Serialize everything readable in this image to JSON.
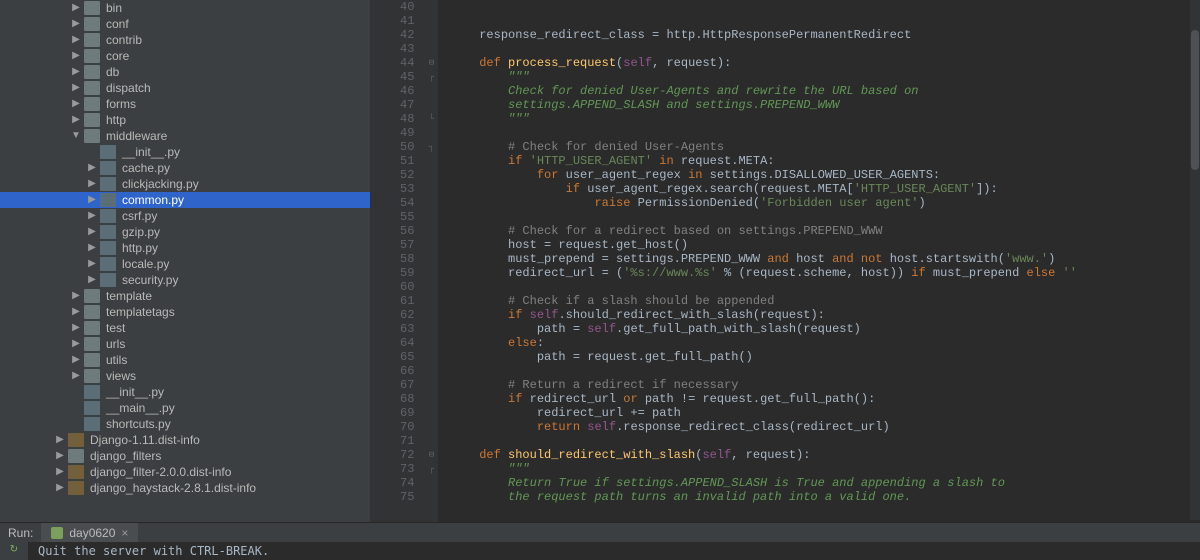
{
  "tree": [
    {
      "depth": 3,
      "arrow": "right",
      "icon": "folder",
      "label": "bin"
    },
    {
      "depth": 3,
      "arrow": "right",
      "icon": "folder",
      "label": "conf"
    },
    {
      "depth": 3,
      "arrow": "right",
      "icon": "folder",
      "label": "contrib"
    },
    {
      "depth": 3,
      "arrow": "right",
      "icon": "folder",
      "label": "core"
    },
    {
      "depth": 3,
      "arrow": "right",
      "icon": "folder",
      "label": "db"
    },
    {
      "depth": 3,
      "arrow": "right",
      "icon": "folder",
      "label": "dispatch"
    },
    {
      "depth": 3,
      "arrow": "right",
      "icon": "folder",
      "label": "forms"
    },
    {
      "depth": 3,
      "arrow": "right",
      "icon": "folder",
      "label": "http"
    },
    {
      "depth": 3,
      "arrow": "down",
      "icon": "folder",
      "label": "middleware"
    },
    {
      "depth": 4,
      "arrow": "none",
      "icon": "file",
      "label": "__init__.py"
    },
    {
      "depth": 4,
      "arrow": "right",
      "icon": "file",
      "label": "cache.py"
    },
    {
      "depth": 4,
      "arrow": "right",
      "icon": "file",
      "label": "clickjacking.py"
    },
    {
      "depth": 4,
      "arrow": "right",
      "icon": "file",
      "label": "common.py",
      "selected": true
    },
    {
      "depth": 4,
      "arrow": "right",
      "icon": "file",
      "label": "csrf.py"
    },
    {
      "depth": 4,
      "arrow": "right",
      "icon": "file",
      "label": "gzip.py"
    },
    {
      "depth": 4,
      "arrow": "right",
      "icon": "file",
      "label": "http.py"
    },
    {
      "depth": 4,
      "arrow": "right",
      "icon": "file",
      "label": "locale.py"
    },
    {
      "depth": 4,
      "arrow": "right",
      "icon": "file",
      "label": "security.py"
    },
    {
      "depth": 3,
      "arrow": "right",
      "icon": "folder",
      "label": "template"
    },
    {
      "depth": 3,
      "arrow": "right",
      "icon": "folder",
      "label": "templatetags"
    },
    {
      "depth": 3,
      "arrow": "right",
      "icon": "folder",
      "label": "test"
    },
    {
      "depth": 3,
      "arrow": "right",
      "icon": "folder",
      "label": "urls"
    },
    {
      "depth": 3,
      "arrow": "right",
      "icon": "folder",
      "label": "utils"
    },
    {
      "depth": 3,
      "arrow": "right",
      "icon": "folder",
      "label": "views"
    },
    {
      "depth": 3,
      "arrow": "none",
      "icon": "file",
      "label": "__init__.py"
    },
    {
      "depth": 3,
      "arrow": "none",
      "icon": "file",
      "label": "__main__.py"
    },
    {
      "depth": 3,
      "arrow": "none",
      "icon": "file",
      "label": "shortcuts.py"
    },
    {
      "depth": 2,
      "arrow": "right",
      "icon": "dist",
      "label": "Django-1.11.dist-info"
    },
    {
      "depth": 2,
      "arrow": "right",
      "icon": "folder",
      "label": "django_filters"
    },
    {
      "depth": 2,
      "arrow": "right",
      "icon": "dist",
      "label": "django_filter-2.0.0.dist-info"
    },
    {
      "depth": 2,
      "arrow": "right",
      "icon": "dist",
      "label": "django_haystack-2.8.1.dist-info"
    }
  ],
  "lineStart": 40,
  "code": [
    {
      "t": ""
    },
    {
      "t": ""
    },
    {
      "t": "    response_redirect_class = http.HttpResponsePermanentRedirect"
    },
    {
      "t": ""
    },
    {
      "seg": [
        [
          "kw",
          "    def "
        ],
        [
          "fn",
          "process_request"
        ],
        [
          "id",
          "("
        ],
        [
          "self",
          "self"
        ],
        [
          "id",
          ", request):"
        ]
      ]
    },
    {
      "t": "        \"\"\"",
      "cls": "doc"
    },
    {
      "t": "        Check for denied User-Agents and rewrite the URL based on",
      "cls": "doc"
    },
    {
      "t": "        settings.APPEND_SLASH and settings.PREPEND_WWW",
      "cls": "doc"
    },
    {
      "t": "        \"\"\"",
      "cls": "doc"
    },
    {
      "t": ""
    },
    {
      "t": "        # Check for denied User-Agents",
      "cls": "cmt"
    },
    {
      "seg": [
        [
          "id",
          "        "
        ],
        [
          "kw",
          "if "
        ],
        [
          "str",
          "'HTTP_USER_AGENT'"
        ],
        [
          "kw",
          " in "
        ],
        [
          "id",
          "request.META:"
        ]
      ]
    },
    {
      "seg": [
        [
          "id",
          "            "
        ],
        [
          "kw",
          "for "
        ],
        [
          "id",
          "user_agent_regex "
        ],
        [
          "kw",
          "in "
        ],
        [
          "id",
          "settings.DISALLOWED_USER_AGENTS:"
        ]
      ]
    },
    {
      "seg": [
        [
          "id",
          "                "
        ],
        [
          "kw",
          "if "
        ],
        [
          "id",
          "user_agent_regex.search(request.META["
        ],
        [
          "str",
          "'HTTP_USER_AGENT'"
        ],
        [
          "id",
          "]):"
        ]
      ]
    },
    {
      "seg": [
        [
          "id",
          "                    "
        ],
        [
          "kw",
          "raise "
        ],
        [
          "id",
          "PermissionDenied("
        ],
        [
          "str",
          "'Forbidden user agent'"
        ],
        [
          "id",
          ")"
        ]
      ]
    },
    {
      "t": ""
    },
    {
      "t": "        # Check for a redirect based on settings.PREPEND_WWW",
      "cls": "cmt"
    },
    {
      "t": "        host = request.get_host()"
    },
    {
      "seg": [
        [
          "id",
          "        must_prepend = settings.PREPEND_WWW "
        ],
        [
          "kw",
          "and "
        ],
        [
          "id",
          "host "
        ],
        [
          "kw",
          "and not "
        ],
        [
          "id",
          "host.startswith("
        ],
        [
          "str",
          "'www.'"
        ],
        [
          "id",
          ")"
        ]
      ]
    },
    {
      "seg": [
        [
          "id",
          "        redirect_url = ("
        ],
        [
          "str",
          "'%s://www.%s'"
        ],
        [
          "id",
          " % (request.scheme, host)) "
        ],
        [
          "kw",
          "if "
        ],
        [
          "id",
          "must_prepend "
        ],
        [
          "kw",
          "else "
        ],
        [
          "str",
          "''"
        ]
      ]
    },
    {
      "t": ""
    },
    {
      "t": "        # Check if a slash should be appended",
      "cls": "cmt"
    },
    {
      "seg": [
        [
          "id",
          "        "
        ],
        [
          "kw",
          "if "
        ],
        [
          "self",
          "self"
        ],
        [
          "id",
          ".should_redirect_with_slash(request):"
        ]
      ]
    },
    {
      "seg": [
        [
          "id",
          "            path = "
        ],
        [
          "self",
          "self"
        ],
        [
          "id",
          ".get_full_path_with_slash(request)"
        ]
      ]
    },
    {
      "seg": [
        [
          "id",
          "        "
        ],
        [
          "kw",
          "else"
        ],
        [
          "id",
          ":"
        ]
      ]
    },
    {
      "t": "            path = request.get_full_path()"
    },
    {
      "t": ""
    },
    {
      "t": "        # Return a redirect if necessary",
      "cls": "cmt"
    },
    {
      "seg": [
        [
          "id",
          "        "
        ],
        [
          "kw",
          "if "
        ],
        [
          "id",
          "redirect_url "
        ],
        [
          "kw",
          "or "
        ],
        [
          "id",
          "path != request.get_full_path():"
        ]
      ]
    },
    {
      "t": "            redirect_url += path"
    },
    {
      "seg": [
        [
          "id",
          "            "
        ],
        [
          "kw",
          "return "
        ],
        [
          "self",
          "self"
        ],
        [
          "id",
          ".response_redirect_class(redirect_url)"
        ]
      ]
    },
    {
      "t": ""
    },
    {
      "seg": [
        [
          "kw",
          "    def "
        ],
        [
          "fn",
          "should_redirect_with_slash"
        ],
        [
          "id",
          "("
        ],
        [
          "self",
          "self"
        ],
        [
          "id",
          ", request):"
        ]
      ]
    },
    {
      "t": "        \"\"\"",
      "cls": "doc"
    },
    {
      "t": "        Return True if settings.APPEND_SLASH is True and appending a slash to",
      "cls": "doc"
    },
    {
      "t": "        the request path turns an invalid path into a valid one.",
      "cls": "doc"
    }
  ],
  "fold": {
    "44": "⊟",
    "45": "┌",
    "48": "└",
    "50": "┐",
    "72": "⊟",
    "73": "┌"
  },
  "run": {
    "label": "Run:",
    "tab": "day0620"
  },
  "console": "Quit the server with CTRL-BREAK."
}
